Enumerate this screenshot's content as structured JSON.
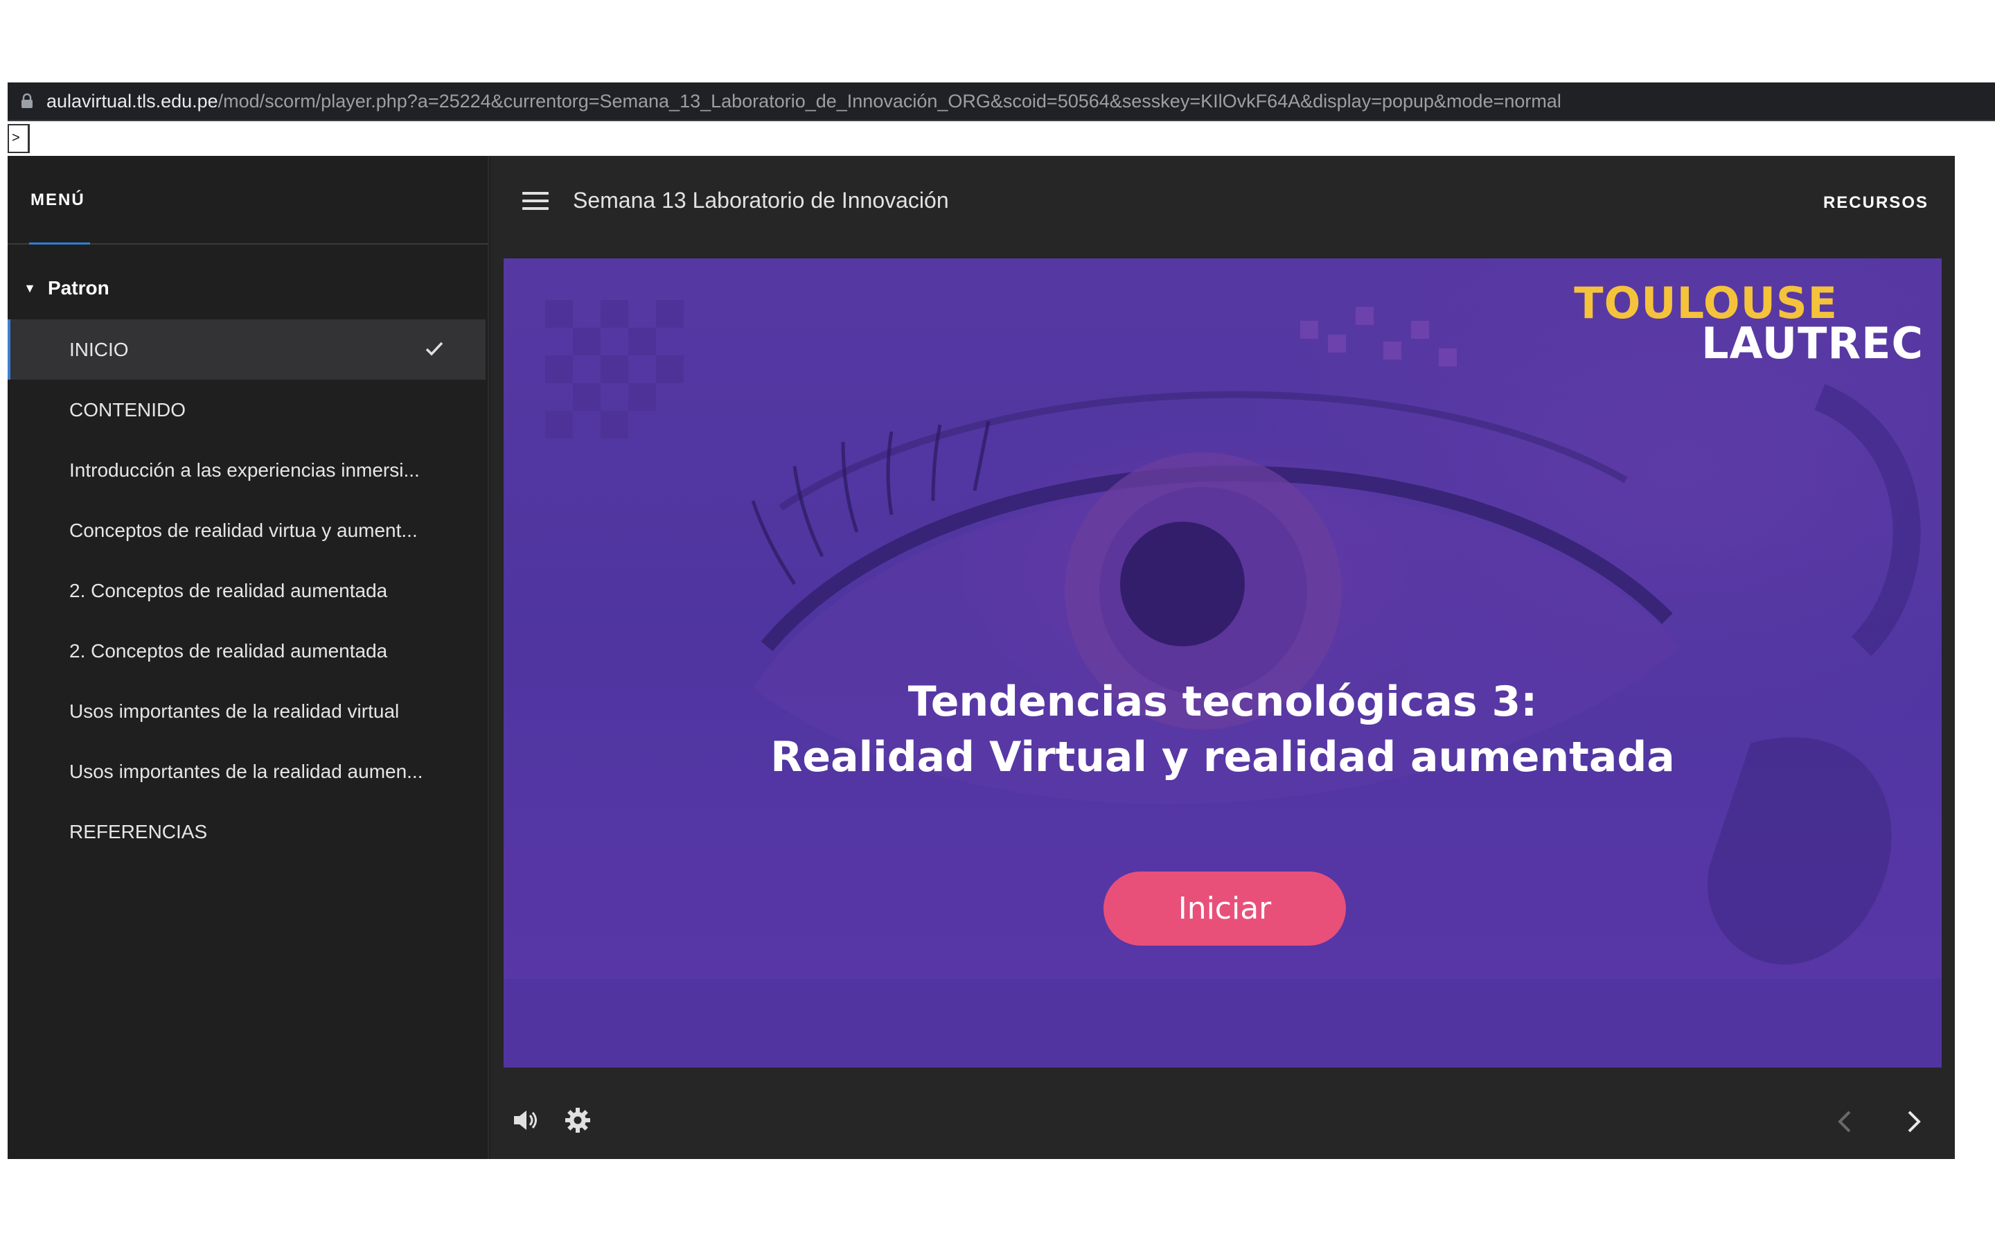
{
  "browser": {
    "url_host": "aulavirtual.tls.edu.pe",
    "url_path": "/mod/scorm/player.php?a=25224&currentorg=Semana_13_Laboratorio_de_Innovación_ORG&scoid=50564&sesskey=KIlOvkF64A&display=popup&mode=normal",
    "toggle_label": ">"
  },
  "sidebar": {
    "title": "MENÚ",
    "group": "Patron",
    "items": [
      {
        "label": "INICIO",
        "active": true,
        "completed": true
      },
      {
        "label": "CONTENIDO"
      },
      {
        "label": "Introducción a las experiencias inmersi..."
      },
      {
        "label": "Conceptos de realidad virtua y aument..."
      },
      {
        "label": "2. Conceptos de realidad aumentada"
      },
      {
        "label": "2. Conceptos de realidad aumentada"
      },
      {
        "label": "Usos importantes de la realidad virtual"
      },
      {
        "label": "Usos importantes de la realidad aumen..."
      },
      {
        "label": "REFERENCIAS"
      }
    ]
  },
  "header": {
    "course_title": "Semana 13 Laboratorio de Innovación",
    "resources_label": "RECURSOS"
  },
  "slide": {
    "logo_line1": "TOULOUSE",
    "logo_line2": "LAUTREC",
    "title_line1": "Tendencias tecnológicas 3:",
    "title_line2": "Realidad Virtual y realidad aumentada",
    "start_button": "Iniciar"
  },
  "footer": {
    "icons": [
      "volume-icon",
      "settings-gear-icon",
      "previous-chevron-icon",
      "next-chevron-icon"
    ]
  },
  "colors": {
    "accent_blue": "#2f7fd6",
    "start_button": "#e8507a",
    "logo_yellow": "#f5c33b",
    "slide_purple": "#5638a2"
  }
}
